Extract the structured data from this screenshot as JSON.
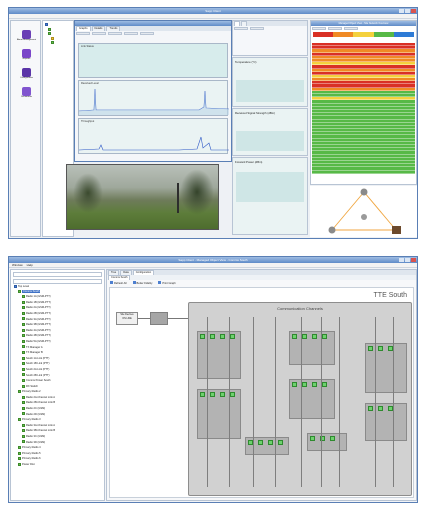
{
  "top": {
    "app_title": "Sapp Client",
    "sidebar": {
      "items": [
        {
          "label": "Alarm Management",
          "icon": "alarm-icon"
        },
        {
          "label": "Reports",
          "icon": "report-icon"
        },
        {
          "label": "Configuration",
          "icon": "config-icon"
        },
        {
          "label": "Documents",
          "icon": "document-icon"
        }
      ]
    },
    "graph_window": {
      "tabs": [
        "Graphs",
        "Details",
        "Trends"
      ],
      "graphs": [
        {
          "label": "Link Status"
        },
        {
          "label": "Received Level"
        },
        {
          "label": "Throughput"
        }
      ]
    },
    "middle_panels": {
      "labels": [
        "Temperature (°C)",
        "Received Signal Strength (dBm)",
        "Forward Power (dBm)"
      ]
    },
    "alarm_panel": {
      "title": "Managed Object View - Site Network Overview",
      "colors": {
        "critical": "#d93025",
        "major": "#f08a24",
        "minor": "#f4d13d",
        "normal": "#57b947",
        "info": "#2e7bd6"
      }
    }
  },
  "bottom": {
    "window_title": "Sapp Client - Managed Object View - Comms South",
    "menu": [
      "Window",
      "Help"
    ],
    "tree_root": "Top Level",
    "tabs": [
      "Tree",
      "Data",
      "Configuration"
    ],
    "view_title": "Comms South",
    "site_title": "TTE South",
    "section_title": "Communication Channels",
    "sub_buttons": [
      "Refresh All",
      "Better Fidelity",
      "Print Graph"
    ],
    "left_box_lines": [
      "Site Devices",
      "ON LINE"
    ],
    "tree_items": [
      "Radio 1A (GSM-PTT)",
      "Radio 1B (GSM-PTT)",
      "Radio 2A (GSM-PTT)",
      "Radio 2B (GSM-PTT)",
      "Radio 3A (GSM-PTT)",
      "Radio 3B (GSM-PTT)",
      "Radio 4A (GSM-PTT)",
      "Radio 4B (GSM-PTT)",
      "Radio 5A (GSM-PTT)",
      "TX Manager A",
      "TX Manager B",
      "South 1A Link (PTT)",
      "South 1B Link (PTT)",
      "South 2A Link (PTT)",
      "South 2B Link (PTT)",
      "Comms Power South",
      "RX Switch",
      "Primary Radio 2",
      "Radio 2A-Channel Link A",
      "Radio 2B-Channel Link B",
      "Radio 2C (GSM)",
      "Radio 2D (GSM)",
      "Primary Radio 3",
      "Radio 3A-Channel Link A",
      "Radio 3B-Channel Link B",
      "Radio 3C (GSM)",
      "Radio 3D (GSM)",
      "Primary Radio 4",
      "Primary Radio 5",
      "Primary Radio 6",
      "Power Dist"
    ]
  }
}
